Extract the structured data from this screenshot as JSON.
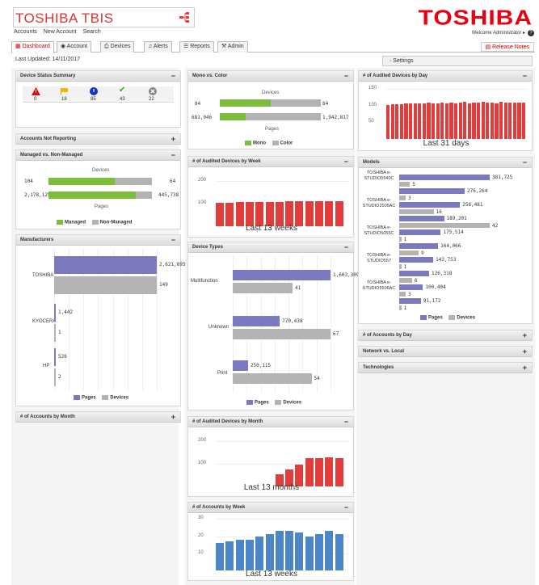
{
  "app": {
    "logo_text": "TOSHIBA TBIS",
    "brand": "TOSHIBA"
  },
  "toplinks": [
    "Accounts",
    "New Account",
    "Search"
  ],
  "welcome": "Welcome Administrator ▸",
  "tabs": [
    "Dashboard",
    "Account",
    "Devices",
    "Alerts",
    "Reports",
    "Admin"
  ],
  "release_notes": "Release Notes",
  "last_updated": "Last Updated: 14/11/2017",
  "settings_label": "Settings",
  "colors": {
    "accent": "#e60012",
    "green": "#7cbd3c",
    "gray": "#b3b3b3",
    "purple": "#7b7ac1",
    "red": "#e23d3d",
    "blue": "#4a86c8"
  },
  "device_status": {
    "title": "Device Status Summary",
    "counts": [
      "0",
      "18",
      "85",
      "43",
      "22"
    ]
  },
  "accounts_not_reporting": {
    "title": "Accounts Not Reporting"
  },
  "managed": {
    "title": "Managed vs. Non-Managed",
    "devices_label": "Devices",
    "pages_label": "Pages",
    "devices_left": "104",
    "devices_right": "64",
    "pages_left": "2,178,125",
    "pages_right": "445,738",
    "legend": [
      "Managed",
      "Non-Managed"
    ]
  },
  "manufacturers": {
    "title": "Manufacturers",
    "legend": [
      "Pages",
      "Devices"
    ],
    "chart_data": {
      "type": "bar",
      "categories": [
        "TOSHIBA",
        "KYOCERA",
        "HP"
      ],
      "series": [
        {
          "name": "Pages",
          "values": [
            2621895,
            1442,
            526
          ]
        },
        {
          "name": "Devices",
          "values": [
            149,
            1,
            2
          ]
        }
      ],
      "value_labels": {
        "pages": [
          "2,621,895",
          "1,442",
          "526"
        ],
        "devices": [
          "149",
          "1",
          "2"
        ]
      }
    }
  },
  "accounts_by_month": {
    "title": "# of Accounts by Month"
  },
  "mono_color": {
    "title": "Mono vs. Color",
    "devices_label": "Devices",
    "pages_label": "Pages",
    "devices_left": "84",
    "devices_right": "84",
    "pages_left": "681,046",
    "pages_right": "1,942,817",
    "legend": [
      "Mono",
      "Color"
    ]
  },
  "audited_week": {
    "title": "# of Audited Devices by Week",
    "caption": "Last 13 weeks",
    "chart_data": {
      "type": "bar",
      "yticks": [
        "200",
        "100"
      ],
      "ylim": [
        0,
        250
      ],
      "values": [
        105,
        105,
        106,
        107,
        107,
        108,
        108,
        109,
        110,
        110,
        111,
        110,
        110
      ]
    }
  },
  "device_types": {
    "title": "Device Types",
    "legend": [
      "Pages",
      "Devices"
    ],
    "chart_data": {
      "type": "bar",
      "categories": [
        "Multifunction",
        "Unknown",
        "Print"
      ],
      "series": [
        {
          "name": "Pages",
          "values": [
            1603309,
            770438,
            250115
          ]
        },
        {
          "name": "Devices",
          "values": [
            41,
            67,
            54
          ]
        }
      ],
      "value_labels": {
        "pages": [
          "1,603,309",
          "770,438",
          "250,115"
        ],
        "devices": [
          "41",
          "67",
          "54"
        ]
      }
    }
  },
  "audited_month": {
    "title": "# of Audited Devices by Month",
    "caption": "Last 13 months",
    "chart_data": {
      "type": "bar",
      "yticks": [
        "200",
        "100"
      ],
      "ylim": [
        0,
        250
      ],
      "values": [
        0,
        0,
        0,
        0,
        0,
        0,
        55,
        75,
        95,
        125,
        125,
        130,
        125
      ]
    }
  },
  "accounts_week": {
    "title": "# of Accounts by Week",
    "caption": "Last 13 weeks",
    "chart_data": {
      "type": "bar",
      "yticks": [
        "30",
        "20",
        "10"
      ],
      "ylim": [
        0,
        33
      ],
      "values": [
        16,
        17,
        18,
        18,
        20,
        21,
        23,
        23,
        22,
        20,
        21,
        23,
        21
      ]
    }
  },
  "audited_day": {
    "title": "# of Audited Devices by Day",
    "caption": "Last 31 days",
    "chart_data": {
      "type": "bar",
      "yticks": [
        "150",
        "100",
        "50"
      ],
      "ylim": [
        0,
        170
      ],
      "values": [
        103,
        104,
        105,
        105,
        106,
        107,
        107,
        108,
        108,
        109,
        108,
        107,
        110,
        108,
        109,
        108,
        110,
        112,
        108,
        110,
        109,
        111,
        109,
        110,
        108,
        111,
        110,
        109,
        110,
        110,
        110
      ]
    }
  },
  "models": {
    "title": "Models",
    "legend": [
      "Pages",
      "Devices"
    ],
    "chart_data": {
      "type": "bar",
      "categories": [
        "TOSHIBA e-STUDIO5540C",
        "TOSHIBA e-STUDIO2505AC",
        "TOSHIBA e-STUDIO5055C",
        "TOSHIBA e-STUDIO557",
        "TOSHIBA e-STUDIO5506AC"
      ],
      "series": [
        {
          "name": "Pages",
          "values": [
            381725,
            276264,
            256481,
            189201,
            175514,
            164066,
            143753,
            126318,
            100404,
            91172
          ]
        },
        {
          "name": "Devices",
          "values": [
            5,
            3,
            16,
            42,
            1,
            9,
            1,
            6,
            3,
            1
          ]
        }
      ],
      "value_labels": {
        "pages": [
          "381,725",
          "276,264",
          "256,481",
          "189,201",
          "175,514",
          "164,066",
          "143,753",
          "126,318",
          "100,404",
          "91,172"
        ],
        "devices": [
          "5",
          "3",
          "16",
          "42",
          "1",
          "9",
          "1",
          "6",
          "3",
          "1"
        ]
      }
    }
  },
  "accounts_by_day": {
    "title": "# of Accounts by Day"
  },
  "network_local": {
    "title": "Network vs. Local"
  },
  "technologies": {
    "title": "Technologies"
  }
}
